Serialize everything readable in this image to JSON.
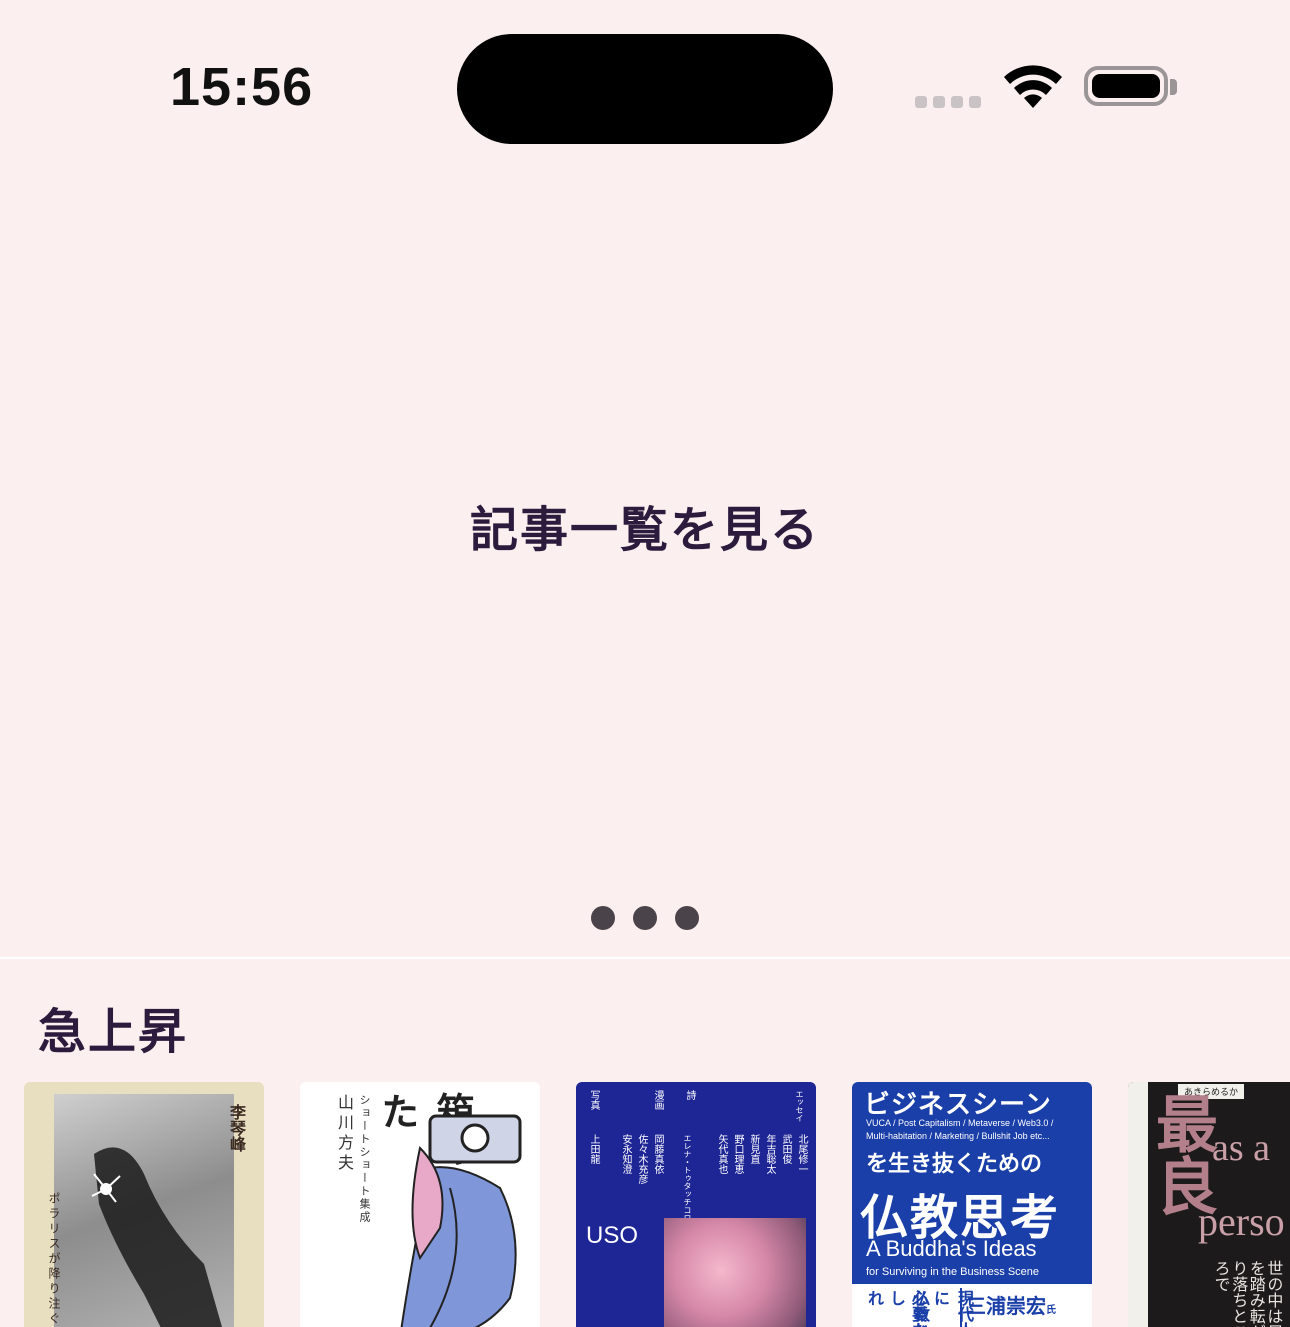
{
  "status_bar": {
    "time": "15:56"
  },
  "hero": {
    "link_label": "記事一覧を見る",
    "page_count": 3,
    "current_page": 1
  },
  "section": {
    "title": "急上昇"
  },
  "books": [
    {
      "author": "李琴峰",
      "title": "ポラリスが降り注ぐ夜",
      "bg": "#e7dfc0"
    },
    {
      "title": "箱の中のあなた",
      "subtitle": "ショートショート集成",
      "author": "山川方夫",
      "bg": "#ffffff"
    },
    {
      "title": "USO",
      "labels": [
        "写真",
        "漫画",
        "詩",
        "エッセイ"
      ],
      "authors": [
        "上田龍",
        "安永知澄",
        "佐々木充彦",
        "岡藤真依",
        "エレナ・トゥタッチコワ",
        "矢代真也",
        "野口理恵",
        "新見直",
        "年吉聡太",
        "武田俊",
        "北尾修一"
      ],
      "bg": "#1e2595"
    },
    {
      "top_title": "ビジネスシーン",
      "keywords_1": "VUCA / Post Capitalism / Metaverse / Web3.0 /",
      "keywords_2": "Multi-habitation / Marketing / Bullshit Job etc...",
      "lead": "を生き抜くための",
      "main_title": "仏教思考",
      "english_title": "A Buddha's Ideas",
      "english_sub": "for Surviving in the Business Scene",
      "vertical_1": "現代人に",
      "vertical_2": "必要な",
      "vertical_3": "仏教とし",
      "vertical_4": "れ",
      "author": "三浦崇宏",
      "author_suffix": "氏",
      "bg": "#1a3fa8"
    },
    {
      "top_text": "あきらめるか",
      "main_chars": "最良",
      "english": "as a",
      "english_2": "perso",
      "side_text": "世の中は足を踏み転がり落ちところで",
      "bg": "#1c1a1a"
    }
  ]
}
